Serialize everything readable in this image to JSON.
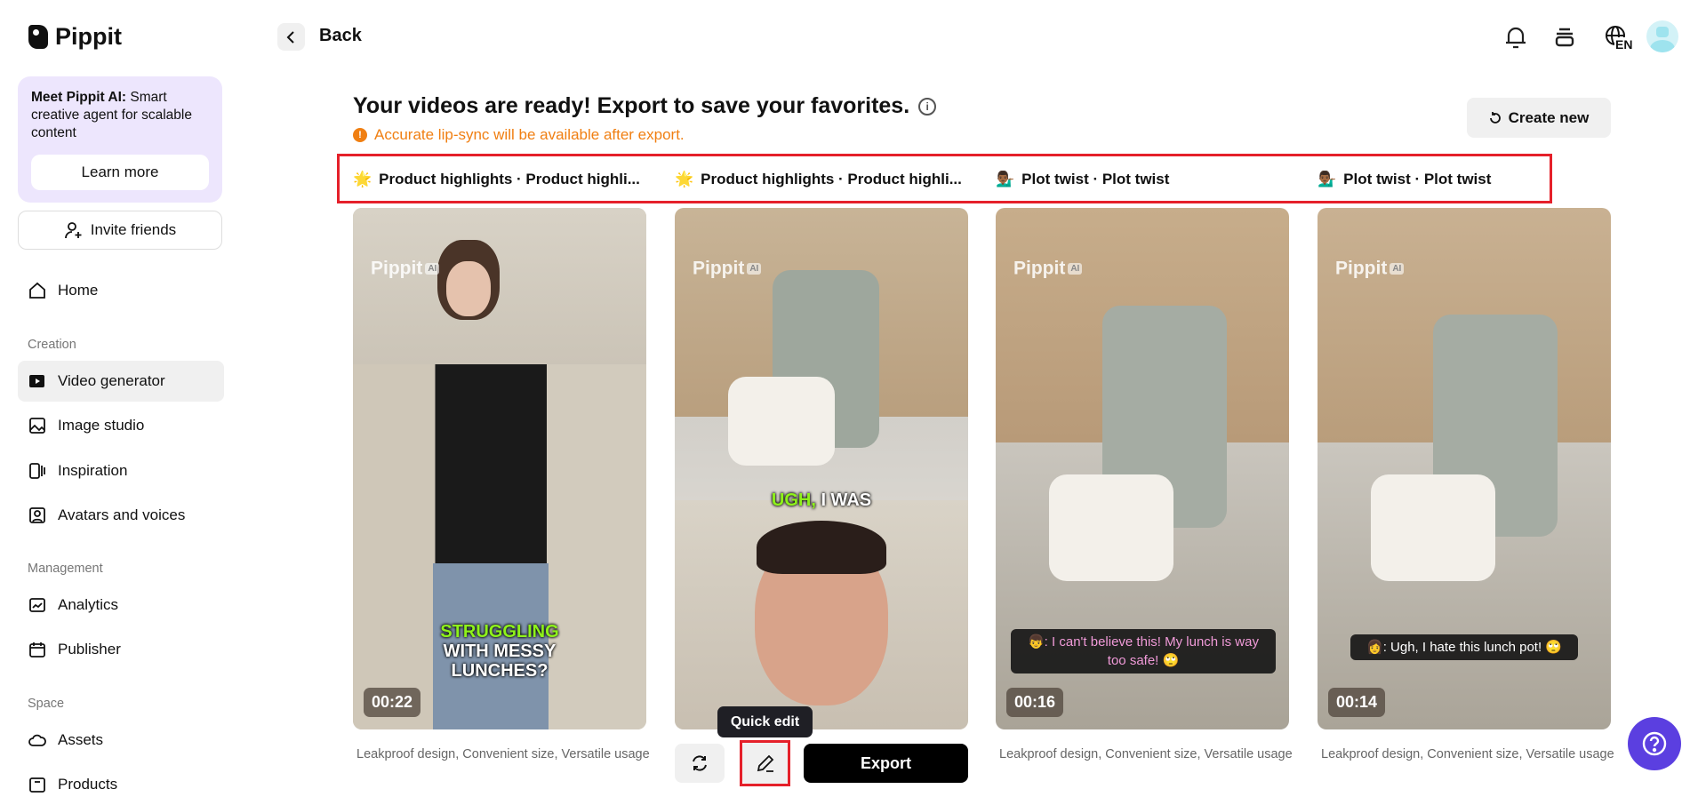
{
  "brand": {
    "name": "Pippit"
  },
  "promo": {
    "bold": "Meet Pippit AI:",
    "text": " Smart creative agent for scalable content",
    "button": "Learn more"
  },
  "invite": "Invite friends",
  "nav": {
    "home": "Home",
    "section_creation": "Creation",
    "video_generator": "Video generator",
    "image_studio": "Image studio",
    "inspiration": "Inspiration",
    "avatars_voices": "Avatars and voices",
    "section_management": "Management",
    "analytics": "Analytics",
    "publisher": "Publisher",
    "section_space": "Space",
    "assets": "Assets",
    "products": "Products"
  },
  "header": {
    "back": "Back",
    "lang": "EN"
  },
  "main": {
    "title": "Your videos are ready! Export to save your favorites.",
    "warning": "Accurate lip-sync will be available after export.",
    "create_new": "Create new",
    "tabs": [
      {
        "emoji": "🌟",
        "label": "Product highlights · Product highli..."
      },
      {
        "emoji": "🌟",
        "label": "Product highlights · Product highli..."
      },
      {
        "emoji": "💁🏾‍♂️",
        "label": "Plot twist · Plot twist"
      },
      {
        "emoji": "💁🏾‍♂️",
        "label": "Plot twist · Plot twist"
      }
    ],
    "watermark": "Pippit",
    "watermark_badge": "AI",
    "cards": [
      {
        "duration": "00:22",
        "caption_green": "STRUGGLING",
        "caption_white": "WITH MESSY LUNCHES?",
        "description": "Leakproof design, Convenient size, Versatile usage"
      },
      {
        "caption_green": "UGH,",
        "caption_white": "I WAS"
      },
      {
        "duration": "00:16",
        "subtitle": "👦: I can't believe this! My lunch is way too safe! 🙄",
        "description": "Leakproof design, Convenient size, Versatile usage"
      },
      {
        "duration": "00:14",
        "subtitle": "👩: Ugh, I hate this lunch pot! 🙄",
        "description": "Leakproof design, Convenient size, Versatile usage"
      }
    ],
    "tooltip": "Quick edit",
    "export": "Export"
  },
  "colors": {
    "accent": "#5b3fe0",
    "warning": "#f07f12",
    "highlight": "#e5202a"
  }
}
